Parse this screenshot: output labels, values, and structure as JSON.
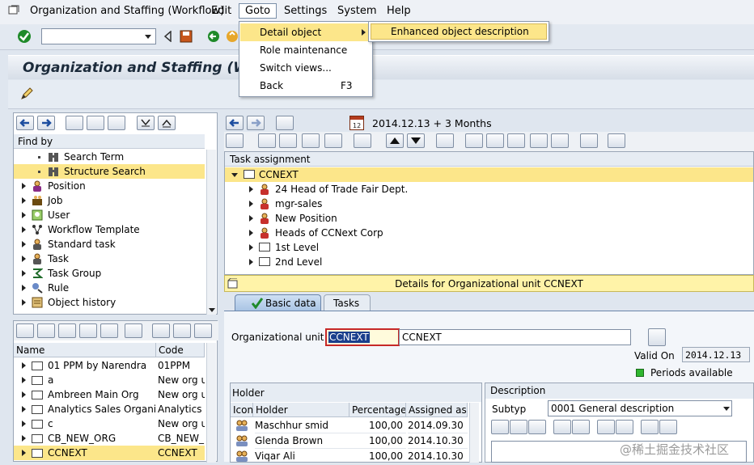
{
  "menubar": {
    "items": [
      "Organization and Staffing (Workflow)",
      "Edit",
      "Goto",
      "Settings",
      "System",
      "Help"
    ]
  },
  "goto_menu": {
    "items": [
      {
        "label": "Detail object",
        "shortcut": ""
      },
      {
        "label": "Role maintenance",
        "shortcut": ""
      },
      {
        "label": "Switch views...",
        "shortcut": ""
      },
      {
        "label": "Back",
        "shortcut": "F3"
      }
    ],
    "submenu": [
      "Enhanced object description"
    ]
  },
  "title": "Organization and Staffing (Workflow)",
  "find_by": {
    "header": "Find by",
    "items": [
      {
        "label": "Search Term",
        "level": 2,
        "icon": "binoculars-icon"
      },
      {
        "label": "Structure Search",
        "level": 2,
        "icon": "binoculars-icon",
        "selected": true
      },
      {
        "label": "Position",
        "level": 1,
        "icon": "person-icon"
      },
      {
        "label": "Job",
        "level": 1,
        "icon": "job-icon"
      },
      {
        "label": "User",
        "level": 1,
        "icon": "user-icon"
      },
      {
        "label": "Workflow Template",
        "level": 1,
        "icon": "workflow-icon"
      },
      {
        "label": "Standard task",
        "level": 1,
        "icon": "task-icon"
      },
      {
        "label": "Task",
        "level": 1,
        "icon": "task-icon"
      },
      {
        "label": "Task Group",
        "level": 1,
        "icon": "taskgroup-icon"
      },
      {
        "label": "Rule",
        "level": 1,
        "icon": "rule-icon"
      },
      {
        "label": "Object history",
        "level": 1,
        "icon": "history-icon"
      }
    ]
  },
  "hit_list": {
    "columns": [
      "Name",
      "Code"
    ],
    "rows": [
      {
        "name": "01 PPM by Narendra",
        "code": "01PPM"
      },
      {
        "name": "a",
        "code": "New org u"
      },
      {
        "name": "Ambreen Main Org",
        "code": "New org u"
      },
      {
        "name": "Analytics Sales Organizat",
        "code": "Analytics"
      },
      {
        "name": "c",
        "code": "New org u"
      },
      {
        "name": "CB_NEW_ORG",
        "code": "CB_NEW_("
      },
      {
        "name": "CCNEXT",
        "code": "CCNEXT",
        "selected": true
      }
    ]
  },
  "date_range": "2014.12.13 + 3 Months",
  "task_assignment": {
    "header": "Task assignment",
    "root": "CCNEXT",
    "children": [
      {
        "label": "24 Head of Trade Fair Dept.",
        "icon": "person-icon"
      },
      {
        "label": "mgr-sales",
        "icon": "person-icon"
      },
      {
        "label": "New Position",
        "icon": "person-icon"
      },
      {
        "label": "Heads of CCNext Corp",
        "icon": "person-icon"
      },
      {
        "label": "1st Level",
        "icon": "org-icon"
      },
      {
        "label": "2nd Level",
        "icon": "org-icon"
      }
    ]
  },
  "details": {
    "header": "Details for Organizational unit CCNEXT",
    "tabs": [
      "Basic data",
      "Tasks"
    ],
    "org_unit_label": "Organizational unit",
    "org_unit_code": "CCNEXT",
    "org_unit_name": "CCNEXT",
    "valid_on_label": "Valid On",
    "valid_on_value": "2014.12.13",
    "periods_label": "Periods available"
  },
  "holder": {
    "header": "Holder",
    "columns": [
      "Icon",
      "Holder",
      "Percentage",
      "Assigned as c"
    ],
    "rows": [
      {
        "holder": "Maschhur smid",
        "percentage": "100,00",
        "assigned": "2014.09.30"
      },
      {
        "holder": "Glenda Brown",
        "percentage": "100,00",
        "assigned": "2014.10.30"
      },
      {
        "holder": "Viqar Ali",
        "percentage": "100,00",
        "assigned": "2014.10.30"
      }
    ]
  },
  "description": {
    "header": "Description",
    "subtype_label": "Subtyp",
    "subtype_value": "0001 General description"
  },
  "watermark": "@稀土掘金技术社区",
  "colors": {
    "selection": "#fce68a",
    "accent_yellow": "#fff3a8",
    "status_green": "#2fb62f"
  }
}
